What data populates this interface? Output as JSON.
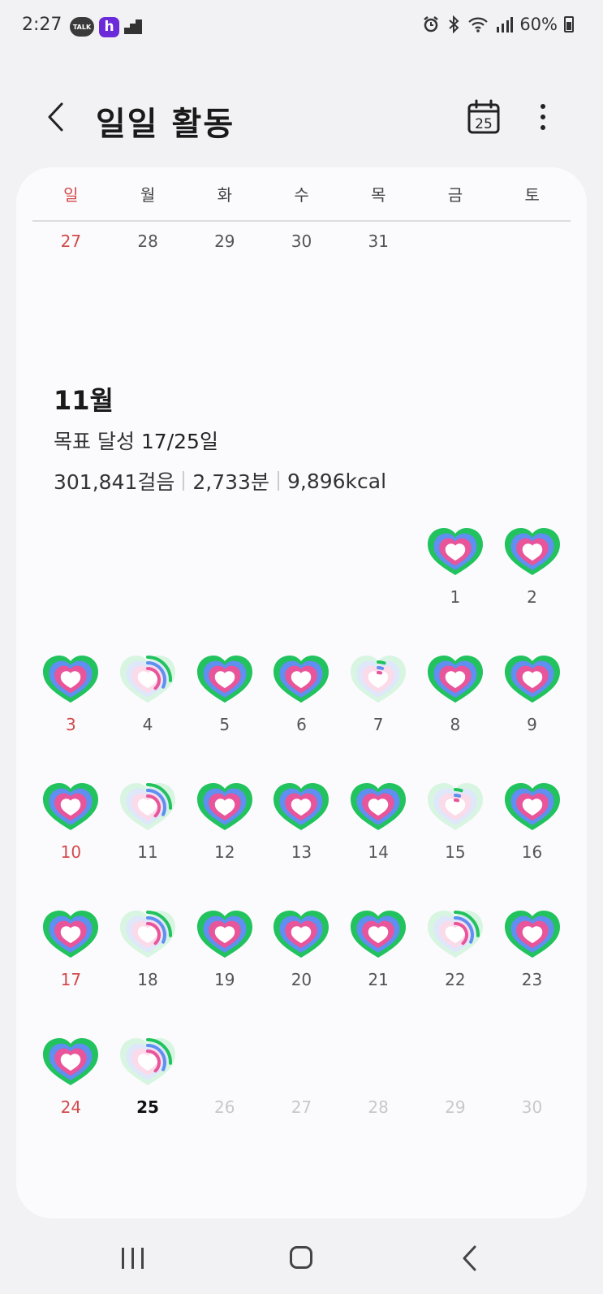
{
  "status": {
    "time": "2:27",
    "kakao_label": "TALK",
    "h_label": "h",
    "battery": "60%"
  },
  "header": {
    "title": "일일 활동",
    "calendar_day": "25"
  },
  "weekdays": [
    "일",
    "월",
    "화",
    "수",
    "목",
    "금",
    "토"
  ],
  "prev_month_row": [
    "27",
    "28",
    "29",
    "30",
    "31",
    "",
    ""
  ],
  "summary": {
    "month": "11월",
    "goal_prefix": "목표 달성",
    "goal_value": "17/25일",
    "steps": "301,841걸음",
    "minutes": "2,733분",
    "kcal": "9,896kcal"
  },
  "days": [
    {
      "day": "1",
      "col": 5,
      "row": 0,
      "status": "full"
    },
    {
      "day": "2",
      "col": 6,
      "row": 0,
      "status": "full"
    },
    {
      "day": "3",
      "col": 0,
      "row": 1,
      "status": "full"
    },
    {
      "day": "4",
      "col": 1,
      "row": 1,
      "status": "partial"
    },
    {
      "day": "5",
      "col": 2,
      "row": 1,
      "status": "full"
    },
    {
      "day": "6",
      "col": 3,
      "row": 1,
      "status": "full"
    },
    {
      "day": "7",
      "col": 4,
      "row": 1,
      "status": "minimal"
    },
    {
      "day": "8",
      "col": 5,
      "row": 1,
      "status": "full"
    },
    {
      "day": "9",
      "col": 6,
      "row": 1,
      "status": "full"
    },
    {
      "day": "10",
      "col": 0,
      "row": 2,
      "status": "full"
    },
    {
      "day": "11",
      "col": 1,
      "row": 2,
      "status": "partial"
    },
    {
      "day": "12",
      "col": 2,
      "row": 2,
      "status": "full"
    },
    {
      "day": "13",
      "col": 3,
      "row": 2,
      "status": "full"
    },
    {
      "day": "14",
      "col": 4,
      "row": 2,
      "status": "full"
    },
    {
      "day": "15",
      "col": 5,
      "row": 2,
      "status": "minimal"
    },
    {
      "day": "16",
      "col": 6,
      "row": 2,
      "status": "full"
    },
    {
      "day": "17",
      "col": 0,
      "row": 3,
      "status": "full"
    },
    {
      "day": "18",
      "col": 1,
      "row": 3,
      "status": "partial"
    },
    {
      "day": "19",
      "col": 2,
      "row": 3,
      "status": "full"
    },
    {
      "day": "20",
      "col": 3,
      "row": 3,
      "status": "full"
    },
    {
      "day": "21",
      "col": 4,
      "row": 3,
      "status": "full"
    },
    {
      "day": "22",
      "col": 5,
      "row": 3,
      "status": "partial"
    },
    {
      "day": "23",
      "col": 6,
      "row": 3,
      "status": "full"
    },
    {
      "day": "24",
      "col": 0,
      "row": 4,
      "status": "full"
    },
    {
      "day": "25",
      "col": 1,
      "row": 4,
      "status": "partial",
      "today": true
    },
    {
      "day": "26",
      "col": 2,
      "row": 4,
      "status": "future"
    },
    {
      "day": "27",
      "col": 3,
      "row": 4,
      "status": "future"
    },
    {
      "day": "28",
      "col": 4,
      "row": 4,
      "status": "future"
    },
    {
      "day": "29",
      "col": 5,
      "row": 4,
      "status": "future"
    },
    {
      "day": "30",
      "col": 6,
      "row": 4,
      "status": "future"
    }
  ],
  "colors": {
    "sunday": "#d24a4a",
    "ring_outer": "#22c35e",
    "ring_middle": "#5f8ff0",
    "ring_inner": "#e8559a"
  }
}
